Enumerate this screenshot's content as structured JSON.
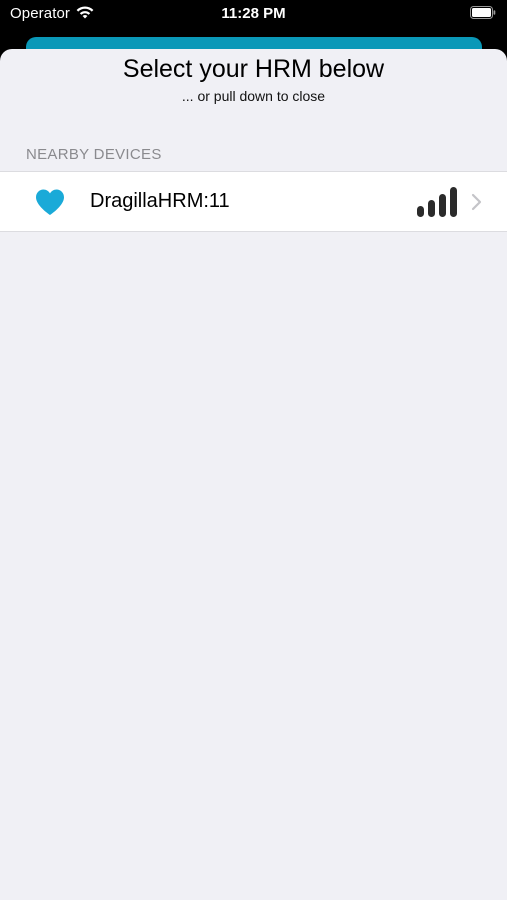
{
  "status_bar": {
    "carrier": "Operator",
    "time": "11:28 PM"
  },
  "sheet": {
    "title": "Select your HRM below",
    "subtitle": "... or pull down to close",
    "section_header": "NEARBY DEVICES",
    "devices": [
      {
        "name": "DragillaHRM:11",
        "icon": "heart-icon",
        "signal_bars": 4,
        "signal_bars_max": 4
      }
    ]
  },
  "colors": {
    "accent": "#0a98b8",
    "heart": "#1aaad8",
    "sheet_background": "#f0f0f5",
    "section_header": "#8a8a8e"
  }
}
